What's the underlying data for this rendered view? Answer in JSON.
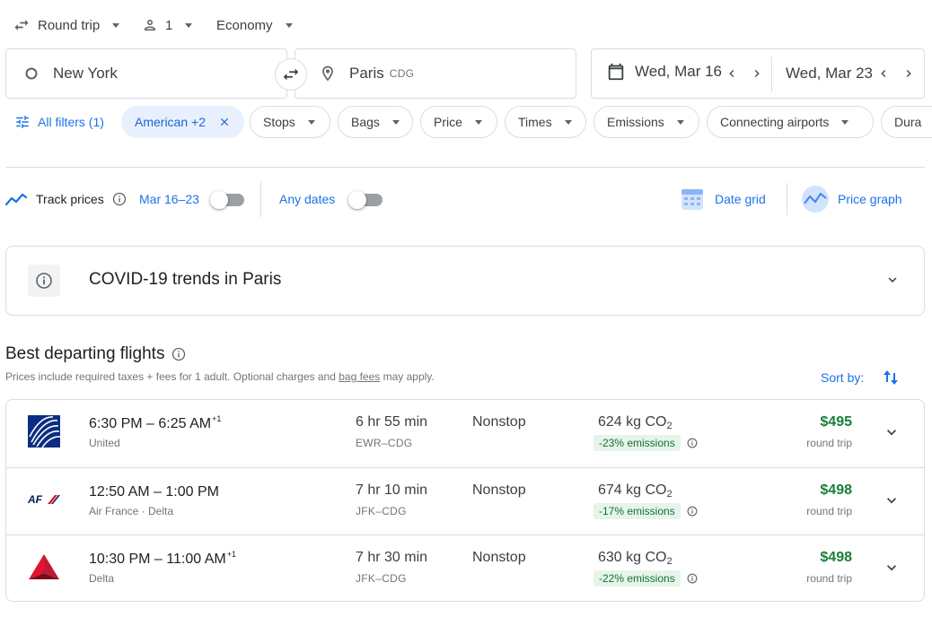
{
  "top": {
    "trip_type": "Round trip",
    "passengers": "1",
    "cabin": "Economy"
  },
  "search": {
    "origin": "New York",
    "destination": "Paris",
    "destination_code": "CDG",
    "depart_date": "Wed, Mar 16",
    "return_date": "Wed, Mar 23"
  },
  "filters": {
    "all_filters": "All filters (1)",
    "airline_chip": "American +2",
    "chips": [
      "Stops",
      "Bags",
      "Price",
      "Times",
      "Emissions",
      "Connecting airports",
      "Dura"
    ]
  },
  "track": {
    "label": "Track prices",
    "date_range": "Mar 16–23",
    "any_dates": "Any dates",
    "date_grid": "Date grid",
    "price_graph": "Price graph"
  },
  "covid": {
    "title": "COVID-19 trends in Paris"
  },
  "results": {
    "heading": "Best departing flights",
    "subtitle_prefix": "Prices include required taxes + fees for 1 adult. Optional charges and ",
    "bag_fees_link": "bag fees",
    "subtitle_suffix": " may apply.",
    "sort_by": "Sort by:",
    "flights": [
      {
        "times": "6:30 PM – 6:25 AM",
        "day_offset": "+1",
        "airline": "United",
        "duration": "6 hr 55 min",
        "route": "EWR–CDG",
        "stops": "Nonstop",
        "co2_value": "624 kg CO",
        "co2_sub": "2",
        "emissions": "-23% emissions",
        "price": "$495",
        "price_note": "round trip"
      },
      {
        "times": "12:50 AM – 1:00 PM",
        "day_offset": "",
        "airline": "Air France · Delta",
        "duration": "7 hr 10 min",
        "route": "JFK–CDG",
        "stops": "Nonstop",
        "co2_value": "674 kg CO",
        "co2_sub": "2",
        "emissions": "-17% emissions",
        "price": "$498",
        "price_note": "round trip"
      },
      {
        "times": "10:30 PM – 11:00 AM",
        "day_offset": "+1",
        "airline": "Delta",
        "duration": "7 hr 30 min",
        "route": "JFK–CDG",
        "stops": "Nonstop",
        "co2_value": "630 kg CO",
        "co2_sub": "2",
        "emissions": "-22% emissions",
        "price": "$498",
        "price_note": "round trip"
      }
    ]
  },
  "colors": {
    "accent_blue": "#1a73e8",
    "price_green": "#188038",
    "emissions_bg": "#e6f4ea",
    "chip_active_bg": "#e8f0fe"
  },
  "airline_logos": {
    "united": "united-globe-logo",
    "air_france": "air-france-logo",
    "delta": "delta-triangle-logo"
  }
}
